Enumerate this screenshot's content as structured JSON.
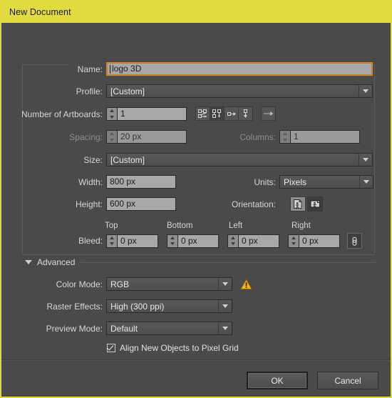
{
  "window": {
    "title": "New Document",
    "titlebar_color": "#e2da41",
    "background_color": "#4a4a4a"
  },
  "fields": {
    "name": {
      "label": "Name:",
      "value": "logo 3D",
      "focused": true
    },
    "profile": {
      "label": "Profile:",
      "value": "[Custom]"
    },
    "number_of_artboards": {
      "label": "Number of Artboards:",
      "value": "1"
    },
    "spacing": {
      "label": "Spacing:",
      "value": "20 px",
      "disabled": true
    },
    "columns": {
      "label": "Columns:",
      "value": "1",
      "disabled": true
    },
    "size": {
      "label": "Size:",
      "value": "[Custom]"
    },
    "width": {
      "label": "Width:",
      "value": "800 px"
    },
    "height": {
      "label": "Height:",
      "value": "600 px"
    },
    "units": {
      "label": "Units:",
      "value": "Pixels"
    },
    "orientation": {
      "label": "Orientation:",
      "portrait_icon": "portrait-page-icon",
      "landscape_icon": "landscape-page-icon",
      "selected": "landscape"
    },
    "bleed": {
      "label": "Bleed:",
      "top_label": "Top",
      "bottom_label": "Bottom",
      "left_label": "Left",
      "right_label": "Right",
      "top": "0 px",
      "bottom": "0 px",
      "left": "0 px",
      "right": "0 px",
      "link_icon": "chain-link-icon"
    }
  },
  "artboard_arrangement": {
    "buttons": [
      {
        "icon": "grid-by-row-icon",
        "active": false
      },
      {
        "icon": "grid-by-column-icon",
        "active": true
      },
      {
        "icon": "arrange-by-row-icon",
        "active": false
      },
      {
        "icon": "arrange-by-column-icon",
        "active": false
      }
    ],
    "flow_button": {
      "icon": "left-to-right-arrow-icon"
    }
  },
  "advanced": {
    "label": "Advanced",
    "expanded": true,
    "disclosure_icon": "chevron-down-icon",
    "color_mode": {
      "label": "Color Mode:",
      "value": "RGB",
      "warning_icon": "warning-triangle-icon",
      "warning_color": "#f2b31c"
    },
    "raster_effects": {
      "label": "Raster Effects:",
      "value": "High (300 ppi)"
    },
    "preview_mode": {
      "label": "Preview Mode:",
      "value": "Default"
    },
    "align_pixel_grid": {
      "label": "Align New Objects to Pixel Grid",
      "checked": true
    }
  },
  "footer": {
    "ok_label": "OK",
    "cancel_label": "Cancel"
  }
}
